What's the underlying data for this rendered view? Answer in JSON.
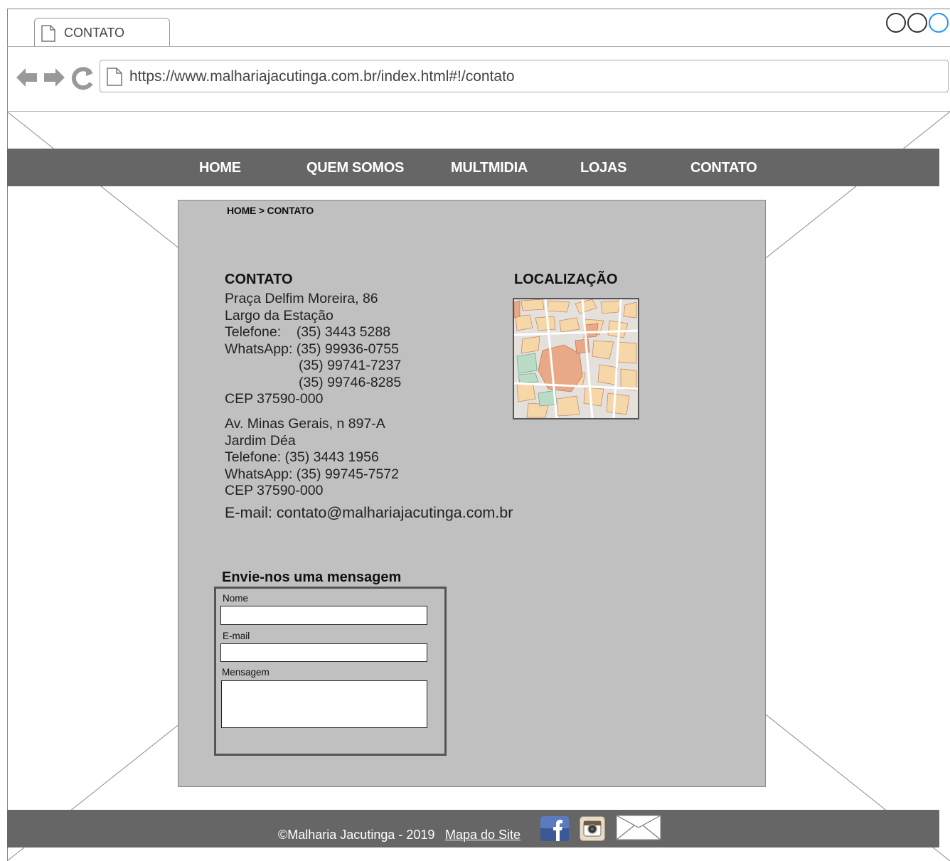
{
  "browser": {
    "tab_title": "CONTATO",
    "url": "https://www.malhariajacutinga.com.br/index.html#!/contato"
  },
  "nav": {
    "items": [
      {
        "label": "HOME"
      },
      {
        "label": "QUEM SOMOS"
      },
      {
        "label": "MULTMIDIA"
      },
      {
        "label": "LOJAS"
      },
      {
        "label": "CONTATO"
      }
    ]
  },
  "breadcrumb": "HOME > CONTATO",
  "contact": {
    "title": "CONTATO",
    "store1": {
      "line1": "Praça Delfim Moreira, 86",
      "line2": "Largo da Estação",
      "phone": "Telefone:    (35) 3443 5288",
      "whatsapp": "WhatsApp: (35) 99936-0755",
      "whatsapp2": "(35) 99741-7237",
      "whatsapp3": "(35) 99746-8285",
      "cep": "CEP 37590-000"
    },
    "store2": {
      "line1": "Av. Minas Gerais, n 897-A",
      "line2": "Jardim Déa",
      "phone": "Telefone: (35) 3443 1956",
      "whatsapp": "WhatsApp: (35) 99745-7572",
      "cep": "CEP 37590-000"
    },
    "email": "E-mail: contato@malhariajacutinga.com.br"
  },
  "location": {
    "title": "LOCALIZAÇÃO"
  },
  "form": {
    "title": "Envie-nos uma mensagem",
    "name_label": "Nome",
    "email_label": "E-mail",
    "message_label": "Mensagem"
  },
  "footer": {
    "copyright": "©Malharia Jacutinga - 2019",
    "sitemap_link": "Mapa do Site"
  },
  "icons": {
    "facebook": "facebook-icon",
    "instagram": "instagram-icon",
    "email": "mail-icon"
  },
  "colors": {
    "bar": "#666666",
    "panel": "#c0c0c0",
    "facebook": "#3b5998"
  }
}
